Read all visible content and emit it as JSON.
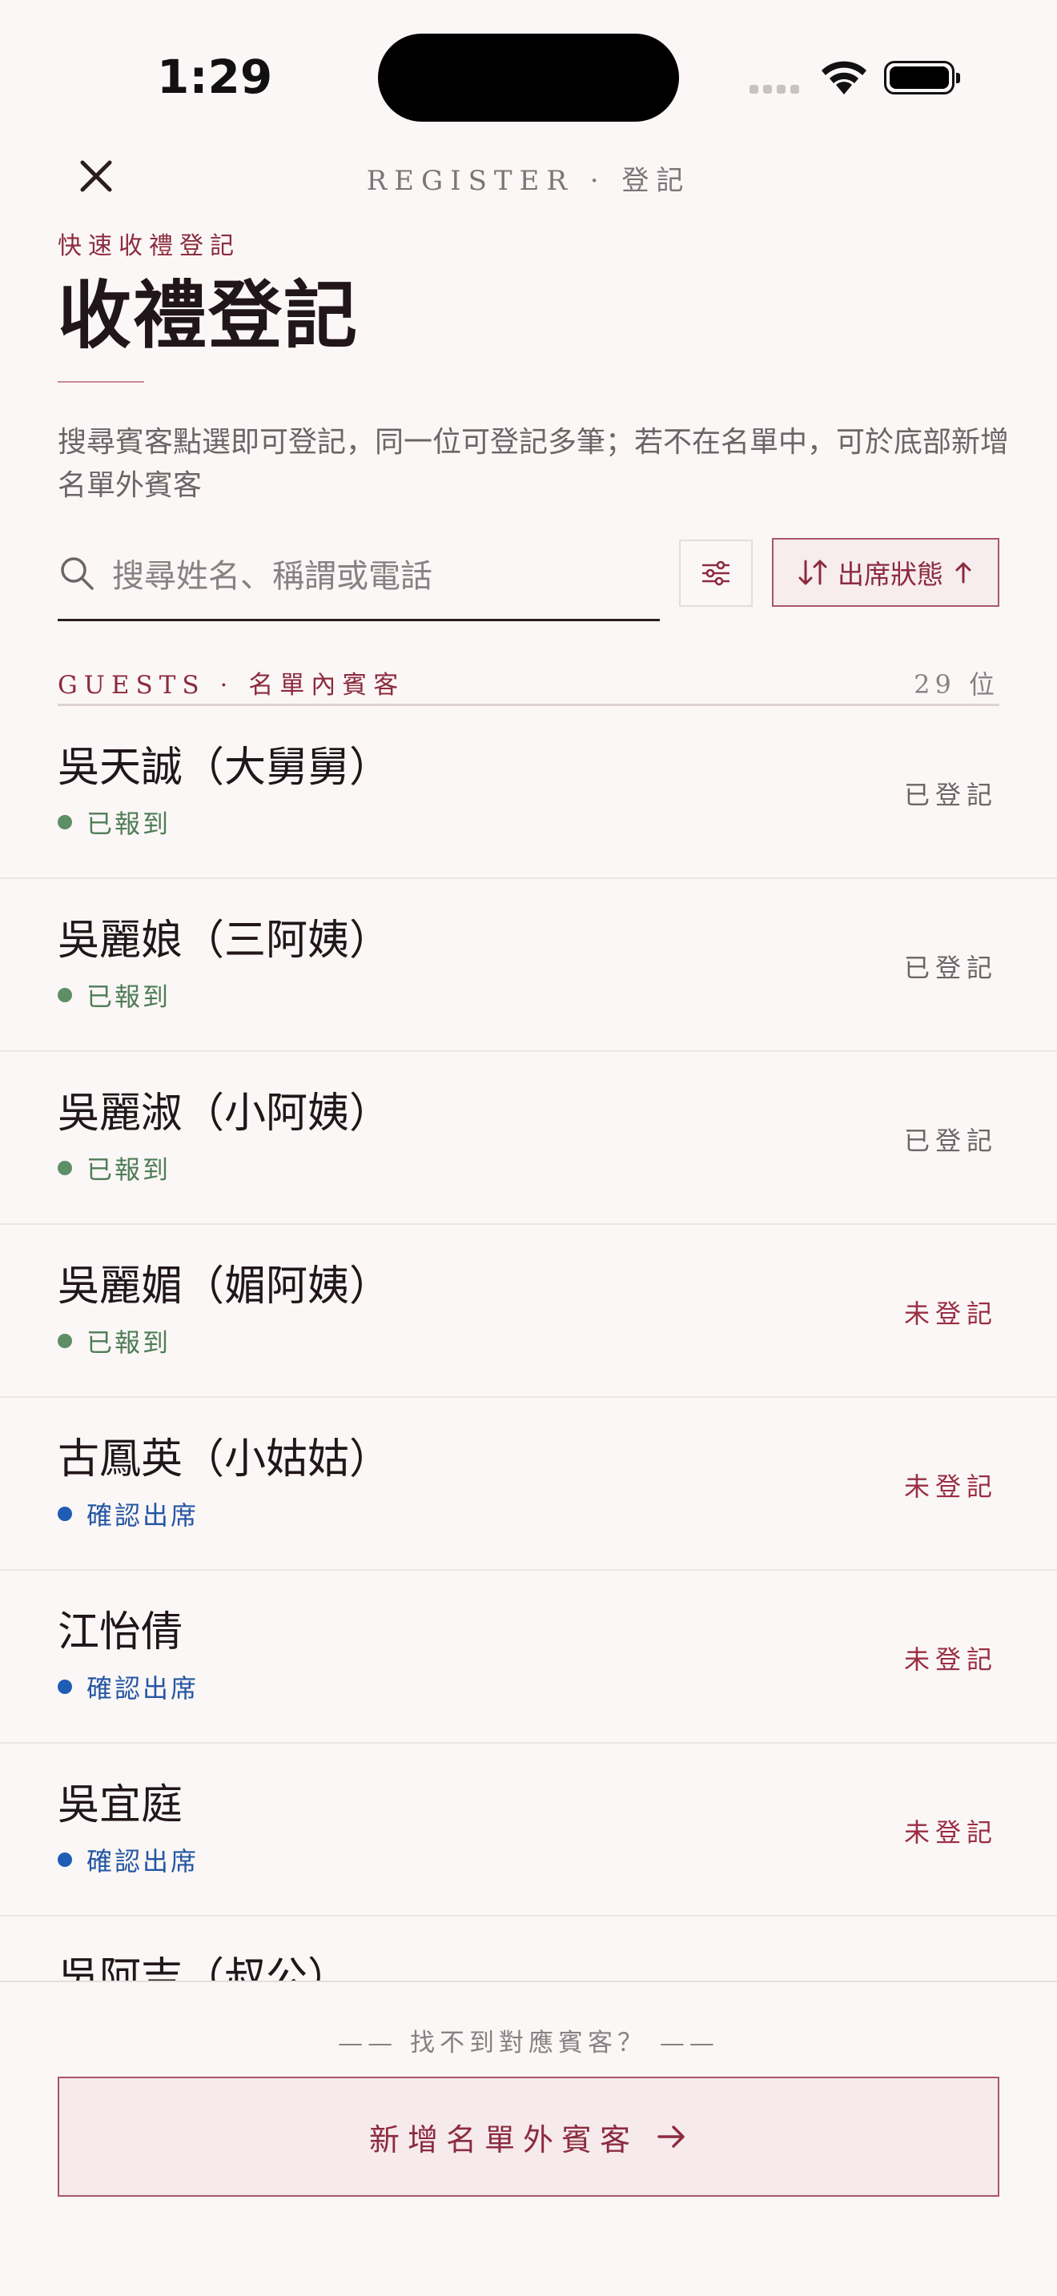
{
  "status_bar": {
    "time": "1:29"
  },
  "header": {
    "title": "REGISTER · 登記"
  },
  "page": {
    "kicker": "快速收禮登記",
    "title": "收禮登記",
    "description": "搜尋賓客點選即可登記，同一位可登記多筆；若不在名單中，可於底部新增名單外賓客"
  },
  "search": {
    "placeholder": "搜尋姓名、稱謂或電話",
    "value": ""
  },
  "sort": {
    "label": "出席狀態"
  },
  "list": {
    "label": "GUESTS · 名單內賓客",
    "count": "29 位",
    "guests": [
      {
        "name": "吳天誠（大舅舅）",
        "status": "已報到",
        "registered": "已登記"
      },
      {
        "name": "吳麗娘（三阿姨）",
        "status": "已報到",
        "registered": "已登記"
      },
      {
        "name": "吳麗淑（小阿姨）",
        "status": "已報到",
        "registered": "已登記"
      },
      {
        "name": "吳麗媚（媚阿姨）",
        "status": "已報到",
        "registered": "未登記"
      },
      {
        "name": "古鳳英（小姑姑）",
        "status": "確認出席",
        "registered": "未登記"
      },
      {
        "name": "江怡倩",
        "status": "確認出席",
        "registered": "未登記"
      },
      {
        "name": "吳宜庭",
        "status": "確認出席",
        "registered": "未登記"
      },
      {
        "name": "吳阿吉（叔公）",
        "status": "",
        "registered": ""
      }
    ]
  },
  "footer": {
    "prompt": "—— 找不到對應賓客？ ——",
    "add_label": "新增名單外賓客"
  },
  "colors": {
    "accent": "#8C2B3F",
    "checked_in": "#5E8E65",
    "confirmed": "#1F5DB5",
    "background": "#FBF7F6"
  }
}
